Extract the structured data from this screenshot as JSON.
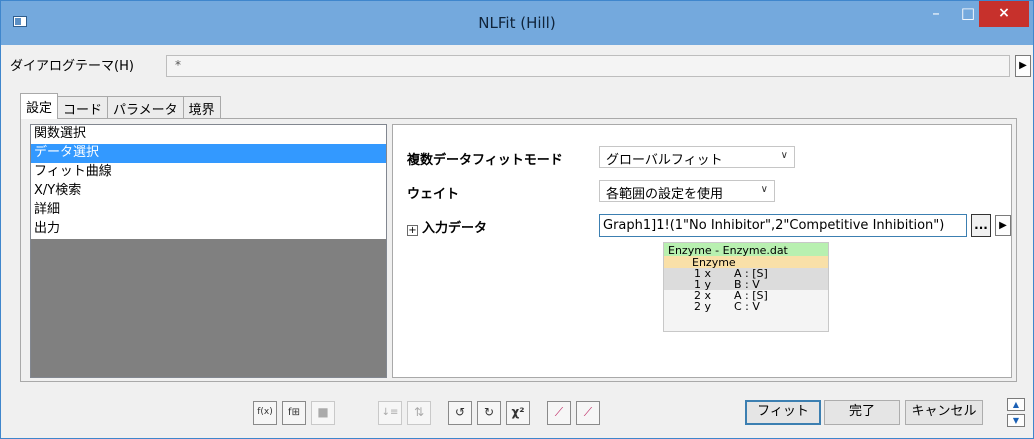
{
  "window": {
    "title": "NLFit (Hill)",
    "minimize_glyph": "–",
    "maximize_glyph": "□",
    "close_glyph": "×"
  },
  "theme": {
    "label": "ダイアログテーマ(H)",
    "value": "*",
    "arrow": "▶"
  },
  "tabs": [
    {
      "label": "設定",
      "active": true
    },
    {
      "label": "コード",
      "active": false
    },
    {
      "label": "パラメータ",
      "active": false
    },
    {
      "label": "境界",
      "active": false
    }
  ],
  "tree": {
    "items": [
      "関数選択",
      "データ選択",
      "フィット曲線",
      "X/Y検索",
      "詳細",
      "出力"
    ],
    "selected_index": 1
  },
  "settings": {
    "multi_fit_label": "複数データフィットモード",
    "multi_fit_value": "グローバルフィット",
    "weight_label": "ウェイト",
    "weight_value": "各範囲の設定を使用",
    "input_label": "入力データ",
    "input_expand": "+",
    "input_value": "Graph1]1!(1\"No Inhibitor\",2\"Competitive Inhibition\")",
    "dots_label": "...",
    "arrow": "▶",
    "chevron": "∨"
  },
  "datatip": {
    "header": "Enzyme - Enzyme.dat",
    "sheet": "Enzyme",
    "rows": [
      {
        "k": "1 x",
        "v": "A : [S]",
        "shade": true
      },
      {
        "k": "1 y",
        "v": "B : V",
        "shade": true
      },
      {
        "k": "2 x",
        "v": "A : [S]",
        "shade": false
      },
      {
        "k": "2 y",
        "v": "C : V",
        "shade": false
      }
    ]
  },
  "toolbar": {
    "fit_label": "フィット",
    "done_label": "完了",
    "cancel_label": "キャンセル",
    "icons": [
      {
        "name": "function-builder-icon",
        "glyph": "f(x)",
        "disabled": false
      },
      {
        "name": "function-organizer-icon",
        "glyph": "f⊞",
        "disabled": false
      },
      {
        "name": "save-icon",
        "glyph": "■",
        "disabled": true
      },
      {
        "name": "sort-icon",
        "glyph": "↓≡",
        "disabled": true
      },
      {
        "name": "reset-icon",
        "glyph": "⇅",
        "disabled": true
      },
      {
        "name": "init-params-icon",
        "glyph": "↺",
        "disabled": false
      },
      {
        "name": "simplex-icon",
        "glyph": "↻",
        "disabled": false
      },
      {
        "name": "chisq-icon",
        "glyph": "χ²",
        "disabled": false
      },
      {
        "name": "one-iteration-icon",
        "glyph": "⟋",
        "disabled": false
      },
      {
        "name": "fit-till-converged-icon",
        "glyph": "⟋",
        "disabled": false
      }
    ],
    "more_up": "▲",
    "more_down": "▼"
  },
  "colors": {
    "titlebar": "#74a9dd",
    "selection": "#3399ff",
    "close": "#c7312c",
    "datatip_header": "#b8f0b0",
    "datatip_sheet": "#f9e0a8"
  }
}
